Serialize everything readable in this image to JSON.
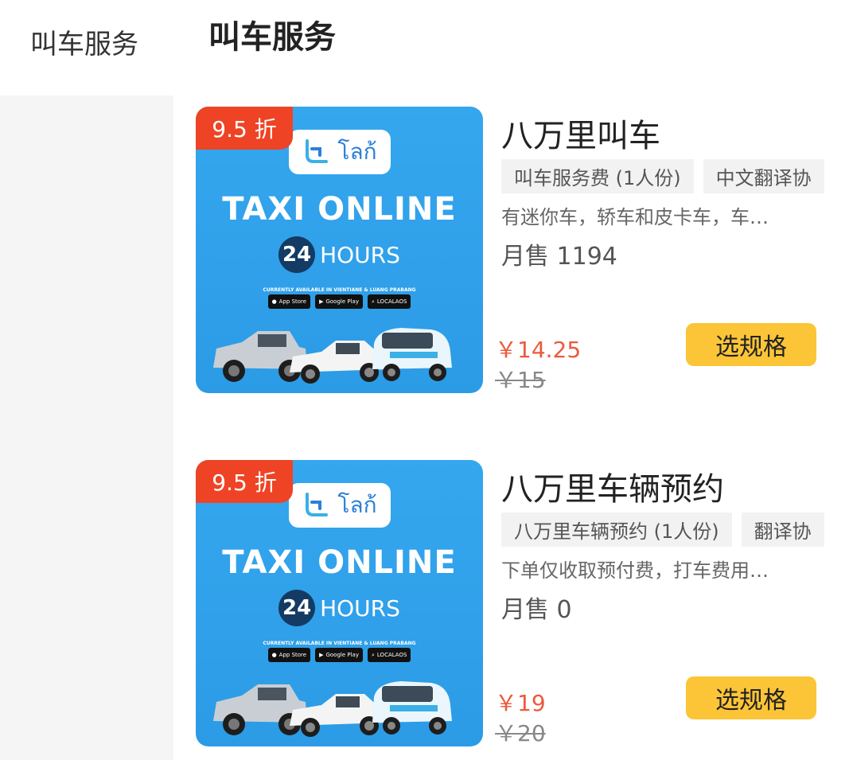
{
  "sidebar": {
    "title": "叫车服务"
  },
  "section": {
    "title": "叫车服务"
  },
  "colors": {
    "accent": "#ec5a3c",
    "button": "#fcc537",
    "badge": "#ee4425",
    "thumb_bg": "#2c9be6"
  },
  "products": [
    {
      "badge": "9.5 折",
      "image": {
        "brand": "โลก้",
        "headline": "TAXI ONLINE",
        "hours_number": "24",
        "hours_label": "HOURS",
        "availability": "CURRENTLY AVAILABLE IN VIENTIANE & LUANG PRABANG",
        "stores": [
          "App Store",
          "Google Play",
          "LOCALAOS"
        ]
      },
      "title": "八万里叫车",
      "tags": [
        "叫车服务费 (1人份)",
        "中文翻译协"
      ],
      "description": "有迷你车，轿车和皮卡车，车…",
      "sales": "月售 1194",
      "price": "￥14.25",
      "original_price": "￥15",
      "button": "选规格"
    },
    {
      "badge": "9.5 折",
      "image": {
        "brand": "โลก้",
        "headline": "TAXI ONLINE",
        "hours_number": "24",
        "hours_label": "HOURS",
        "availability": "CURRENTLY AVAILABLE IN VIENTIANE & LUANG PRABANG",
        "stores": [
          "App Store",
          "Google Play",
          "LOCALAOS"
        ]
      },
      "title": "八万里车辆预约",
      "tags": [
        "八万里车辆预约 (1人份)",
        "翻译协"
      ],
      "description": "下单仅收取预付费，打车费用…",
      "sales": "月售 0",
      "price": "￥19",
      "original_price": "￥20",
      "button": "选规格"
    }
  ]
}
